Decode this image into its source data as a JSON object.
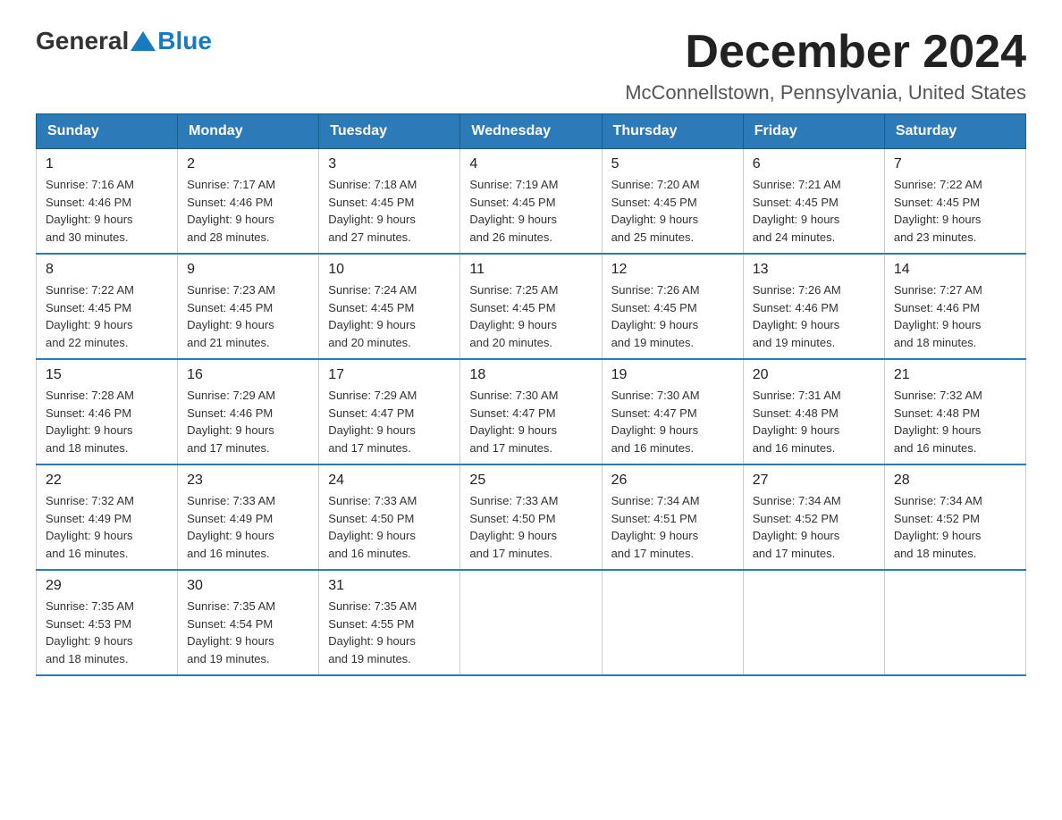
{
  "logo": {
    "general": "General",
    "blue": "Blue"
  },
  "title": "December 2024",
  "location": "McConnellstown, Pennsylvania, United States",
  "days_of_week": [
    "Sunday",
    "Monday",
    "Tuesday",
    "Wednesday",
    "Thursday",
    "Friday",
    "Saturday"
  ],
  "weeks": [
    [
      {
        "day": "1",
        "sunrise": "7:16 AM",
        "sunset": "4:46 PM",
        "daylight": "9 hours and 30 minutes."
      },
      {
        "day": "2",
        "sunrise": "7:17 AM",
        "sunset": "4:46 PM",
        "daylight": "9 hours and 28 minutes."
      },
      {
        "day": "3",
        "sunrise": "7:18 AM",
        "sunset": "4:45 PM",
        "daylight": "9 hours and 27 minutes."
      },
      {
        "day": "4",
        "sunrise": "7:19 AM",
        "sunset": "4:45 PM",
        "daylight": "9 hours and 26 minutes."
      },
      {
        "day": "5",
        "sunrise": "7:20 AM",
        "sunset": "4:45 PM",
        "daylight": "9 hours and 25 minutes."
      },
      {
        "day": "6",
        "sunrise": "7:21 AM",
        "sunset": "4:45 PM",
        "daylight": "9 hours and 24 minutes."
      },
      {
        "day": "7",
        "sunrise": "7:22 AM",
        "sunset": "4:45 PM",
        "daylight": "9 hours and 23 minutes."
      }
    ],
    [
      {
        "day": "8",
        "sunrise": "7:22 AM",
        "sunset": "4:45 PM",
        "daylight": "9 hours and 22 minutes."
      },
      {
        "day": "9",
        "sunrise": "7:23 AM",
        "sunset": "4:45 PM",
        "daylight": "9 hours and 21 minutes."
      },
      {
        "day": "10",
        "sunrise": "7:24 AM",
        "sunset": "4:45 PM",
        "daylight": "9 hours and 20 minutes."
      },
      {
        "day": "11",
        "sunrise": "7:25 AM",
        "sunset": "4:45 PM",
        "daylight": "9 hours and 20 minutes."
      },
      {
        "day": "12",
        "sunrise": "7:26 AM",
        "sunset": "4:45 PM",
        "daylight": "9 hours and 19 minutes."
      },
      {
        "day": "13",
        "sunrise": "7:26 AM",
        "sunset": "4:46 PM",
        "daylight": "9 hours and 19 minutes."
      },
      {
        "day": "14",
        "sunrise": "7:27 AM",
        "sunset": "4:46 PM",
        "daylight": "9 hours and 18 minutes."
      }
    ],
    [
      {
        "day": "15",
        "sunrise": "7:28 AM",
        "sunset": "4:46 PM",
        "daylight": "9 hours and 18 minutes."
      },
      {
        "day": "16",
        "sunrise": "7:29 AM",
        "sunset": "4:46 PM",
        "daylight": "9 hours and 17 minutes."
      },
      {
        "day": "17",
        "sunrise": "7:29 AM",
        "sunset": "4:47 PM",
        "daylight": "9 hours and 17 minutes."
      },
      {
        "day": "18",
        "sunrise": "7:30 AM",
        "sunset": "4:47 PM",
        "daylight": "9 hours and 17 minutes."
      },
      {
        "day": "19",
        "sunrise": "7:30 AM",
        "sunset": "4:47 PM",
        "daylight": "9 hours and 16 minutes."
      },
      {
        "day": "20",
        "sunrise": "7:31 AM",
        "sunset": "4:48 PM",
        "daylight": "9 hours and 16 minutes."
      },
      {
        "day": "21",
        "sunrise": "7:32 AM",
        "sunset": "4:48 PM",
        "daylight": "9 hours and 16 minutes."
      }
    ],
    [
      {
        "day": "22",
        "sunrise": "7:32 AM",
        "sunset": "4:49 PM",
        "daylight": "9 hours and 16 minutes."
      },
      {
        "day": "23",
        "sunrise": "7:33 AM",
        "sunset": "4:49 PM",
        "daylight": "9 hours and 16 minutes."
      },
      {
        "day": "24",
        "sunrise": "7:33 AM",
        "sunset": "4:50 PM",
        "daylight": "9 hours and 16 minutes."
      },
      {
        "day": "25",
        "sunrise": "7:33 AM",
        "sunset": "4:50 PM",
        "daylight": "9 hours and 17 minutes."
      },
      {
        "day": "26",
        "sunrise": "7:34 AM",
        "sunset": "4:51 PM",
        "daylight": "9 hours and 17 minutes."
      },
      {
        "day": "27",
        "sunrise": "7:34 AM",
        "sunset": "4:52 PM",
        "daylight": "9 hours and 17 minutes."
      },
      {
        "day": "28",
        "sunrise": "7:34 AM",
        "sunset": "4:52 PM",
        "daylight": "9 hours and 18 minutes."
      }
    ],
    [
      {
        "day": "29",
        "sunrise": "7:35 AM",
        "sunset": "4:53 PM",
        "daylight": "9 hours and 18 minutes."
      },
      {
        "day": "30",
        "sunrise": "7:35 AM",
        "sunset": "4:54 PM",
        "daylight": "9 hours and 19 minutes."
      },
      {
        "day": "31",
        "sunrise": "7:35 AM",
        "sunset": "4:55 PM",
        "daylight": "9 hours and 19 minutes."
      },
      null,
      null,
      null,
      null
    ]
  ],
  "labels": {
    "sunrise": "Sunrise:",
    "sunset": "Sunset:",
    "daylight": "Daylight: 9 hours"
  }
}
